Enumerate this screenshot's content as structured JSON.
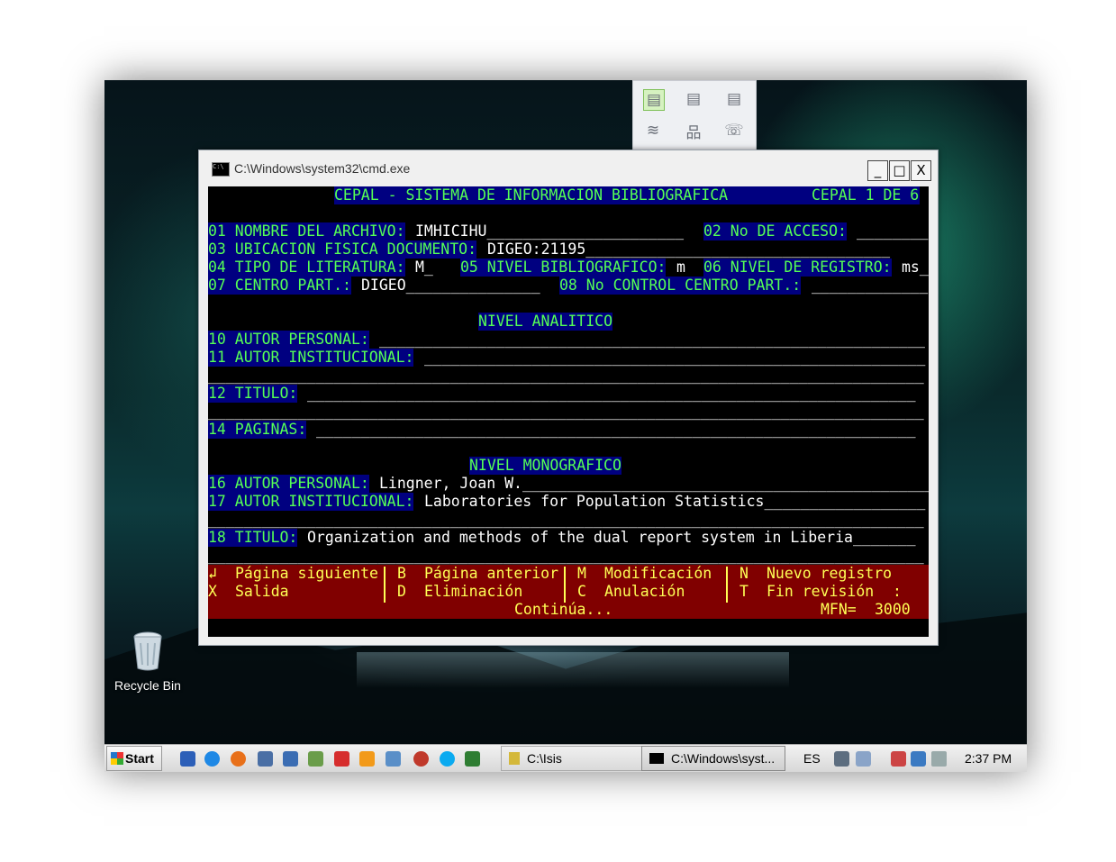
{
  "window": {
    "title": "C:\\Windows\\system32\\cmd.exe",
    "controls": {
      "minimize": "_",
      "maximize": "□",
      "close": "X"
    }
  },
  "form": {
    "header": "CEPAL - SISTEMA DE INFORMACION BIBLIOGRAFICA",
    "page": "CEPAL 1 DE 6",
    "f01_label": "01 NOMBRE DEL ARCHIVO:",
    "f01_value": "IMHICIHU______________________",
    "f02_label": "02 No DE ACCESO:",
    "f02_value": "________",
    "f03_label": "03 UBICACION FISICA DOCUMENTO:",
    "f03_value": "DIGEO:21195__________________________________",
    "f04_label": "04 TIPO DE LITERATURA:",
    "f04_value": "M_",
    "f05_label": "05 NIVEL BIBLIOGRAFICO:",
    "f05_value": "m",
    "f06_label": "06 NIVEL DE REGISTRO:",
    "f06_value": "ms_",
    "f07_label": "07 CENTRO PART.:",
    "f07_value": "DIGEO_______________",
    "f08_label": "08 No CONTROL CENTRO PART.:",
    "f08_value": "_____________",
    "section_analitico": "NIVEL ANALITICO",
    "f10_label": "10 AUTOR PERSONAL:",
    "f10_value": "_____________________________________________________________",
    "f11_label": "11 AUTOR INSTITUCIONAL:",
    "f11_value": "________________________________________________________",
    "f11_cont": "________________________________________________________________________________",
    "f12_label": "12 TITULO:",
    "f12_value": "____________________________________________________________________",
    "f12_cont": "________________________________________________________________________________",
    "f14_label": "14 PAGINAS:",
    "f14_value": "___________________________________________________________________",
    "section_monografico": "NIVEL MONOGRAFICO",
    "f16_label": "16 AUTOR PERSONAL:",
    "f16_value": "Lingner, Joan W.______________________________________________",
    "f17_label": "17 AUTOR INSTITUCIONAL:",
    "f17_value": "Laboratories for Population Statistics__________________",
    "f17_cont": "________________________________________________________________________________",
    "f18_label": "18 TITULO:",
    "f18_value": "Organization and methods of the dual report system in Liberia_______",
    "f18_cont": "________________________________________________________________________________"
  },
  "menu": {
    "enter_key": "↲",
    "enter_label": "Página siguiente",
    "b_key": "B",
    "b_label": "Página anterior",
    "m_key": "M",
    "m_label": "Modificación",
    "n_key": "N",
    "n_label": "Nuevo registro",
    "x_key": "X",
    "x_label": "Salida",
    "d_key": "D",
    "d_label": "Eliminación",
    "c_key": "C",
    "c_label": "Anulación",
    "t_key": "T",
    "t_label": "Fin revisión",
    "t_colon": ":",
    "continua": "Continúa...",
    "mfn_label": "MFN=",
    "mfn_value": "3000"
  },
  "desktop": {
    "recycle_bin": "Recycle Bin"
  },
  "taskbar": {
    "start": "Start",
    "task1": "C:\\Isis",
    "task2": "C:\\Windows\\syst...",
    "lang": "ES",
    "time": "2:37 PM"
  },
  "colors": {
    "console_bg": "#000000",
    "label_bg": "#000080",
    "label_fg": "#55ff55",
    "value_fg": "#ffffff",
    "menu_bg": "#800000",
    "menu_fg": "#ffff55"
  }
}
